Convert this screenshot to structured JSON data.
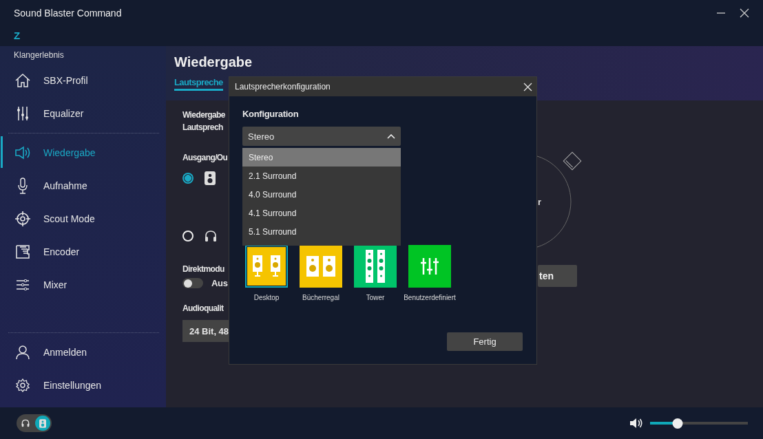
{
  "window": {
    "title": "Sound Blaster Command",
    "logo": "Z"
  },
  "sidebar": {
    "section": "Klangerlebnis",
    "items": [
      {
        "label": "SBX-Profil",
        "selected": false
      },
      {
        "label": "Equalizer",
        "selected": false
      },
      {
        "label": "Wiedergabe",
        "selected": true
      },
      {
        "label": "Aufnahme",
        "selected": false
      },
      {
        "label": "Scout Mode",
        "selected": false
      },
      {
        "label": "Encoder",
        "selected": false
      },
      {
        "label": "Mixer",
        "selected": false
      }
    ],
    "bottom_items": [
      {
        "label": "Anmelden"
      },
      {
        "label": "Einstellungen"
      }
    ]
  },
  "page": {
    "title": "Wiedergabe",
    "tab": {
      "label": "Lautspreche",
      "selected": true
    },
    "section_1": [
      "Wiedergabe",
      "Lautsprech"
    ],
    "output_label": "Ausgang/Ou",
    "outputs": [
      {
        "selected": true
      },
      {
        "selected": false
      }
    ],
    "direct_mode": {
      "label": "Direktmodu",
      "on": false,
      "state": "Aus"
    },
    "quality": {
      "label": "Audioqualit",
      "value": "24 Bit, 48"
    },
    "diagram_label": "r",
    "button": "ten"
  },
  "dialog": {
    "title": "Lautsprecherkonfiguration",
    "label": "Konfiguration",
    "value": "Stereo",
    "options": [
      {
        "label": "Stereo",
        "selected": true
      },
      {
        "label": "2.1 Surround",
        "selected": false
      },
      {
        "label": "4.0 Surround",
        "selected": false
      },
      {
        "label": "4.1 Surround",
        "selected": false
      },
      {
        "label": "5.1 Surround",
        "selected": false
      }
    ],
    "presets": [
      {
        "label": "Desktop",
        "selected": true,
        "color": "#f5c400"
      },
      {
        "label": "Bücherregal",
        "selected": false,
        "color": "#f5c400"
      },
      {
        "label": "Tower",
        "selected": false,
        "color": "#00c46a"
      },
      {
        "label": "Benutzerdefiniert",
        "selected": false,
        "color": "#00c424"
      }
    ],
    "done": "Fertig"
  },
  "status_bar": {
    "device_switch": [
      {
        "selected": false
      },
      {
        "selected": true
      }
    ],
    "volume": {
      "level": 0.28
    }
  }
}
